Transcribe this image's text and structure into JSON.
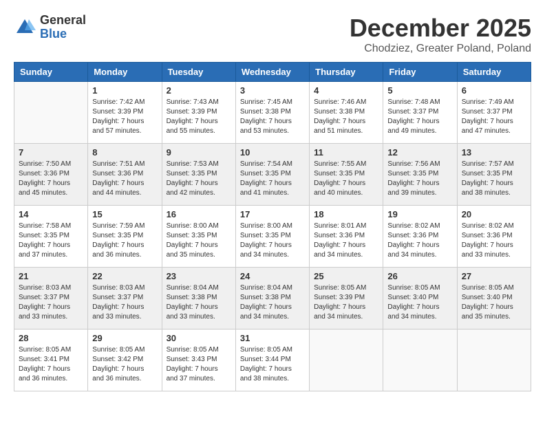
{
  "header": {
    "logo_general": "General",
    "logo_blue": "Blue",
    "month": "December 2025",
    "location": "Chodziez, Greater Poland, Poland"
  },
  "days_of_week": [
    "Sunday",
    "Monday",
    "Tuesday",
    "Wednesday",
    "Thursday",
    "Friday",
    "Saturday"
  ],
  "weeks": [
    [
      {
        "day": "",
        "info": ""
      },
      {
        "day": "1",
        "info": "Sunrise: 7:42 AM\nSunset: 3:39 PM\nDaylight: 7 hours\nand 57 minutes."
      },
      {
        "day": "2",
        "info": "Sunrise: 7:43 AM\nSunset: 3:39 PM\nDaylight: 7 hours\nand 55 minutes."
      },
      {
        "day": "3",
        "info": "Sunrise: 7:45 AM\nSunset: 3:38 PM\nDaylight: 7 hours\nand 53 minutes."
      },
      {
        "day": "4",
        "info": "Sunrise: 7:46 AM\nSunset: 3:38 PM\nDaylight: 7 hours\nand 51 minutes."
      },
      {
        "day": "5",
        "info": "Sunrise: 7:48 AM\nSunset: 3:37 PM\nDaylight: 7 hours\nand 49 minutes."
      },
      {
        "day": "6",
        "info": "Sunrise: 7:49 AM\nSunset: 3:37 PM\nDaylight: 7 hours\nand 47 minutes."
      }
    ],
    [
      {
        "day": "7",
        "info": "Sunrise: 7:50 AM\nSunset: 3:36 PM\nDaylight: 7 hours\nand 45 minutes."
      },
      {
        "day": "8",
        "info": "Sunrise: 7:51 AM\nSunset: 3:36 PM\nDaylight: 7 hours\nand 44 minutes."
      },
      {
        "day": "9",
        "info": "Sunrise: 7:53 AM\nSunset: 3:35 PM\nDaylight: 7 hours\nand 42 minutes."
      },
      {
        "day": "10",
        "info": "Sunrise: 7:54 AM\nSunset: 3:35 PM\nDaylight: 7 hours\nand 41 minutes."
      },
      {
        "day": "11",
        "info": "Sunrise: 7:55 AM\nSunset: 3:35 PM\nDaylight: 7 hours\nand 40 minutes."
      },
      {
        "day": "12",
        "info": "Sunrise: 7:56 AM\nSunset: 3:35 PM\nDaylight: 7 hours\nand 39 minutes."
      },
      {
        "day": "13",
        "info": "Sunrise: 7:57 AM\nSunset: 3:35 PM\nDaylight: 7 hours\nand 38 minutes."
      }
    ],
    [
      {
        "day": "14",
        "info": "Sunrise: 7:58 AM\nSunset: 3:35 PM\nDaylight: 7 hours\nand 37 minutes."
      },
      {
        "day": "15",
        "info": "Sunrise: 7:59 AM\nSunset: 3:35 PM\nDaylight: 7 hours\nand 36 minutes."
      },
      {
        "day": "16",
        "info": "Sunrise: 8:00 AM\nSunset: 3:35 PM\nDaylight: 7 hours\nand 35 minutes."
      },
      {
        "day": "17",
        "info": "Sunrise: 8:00 AM\nSunset: 3:35 PM\nDaylight: 7 hours\nand 34 minutes."
      },
      {
        "day": "18",
        "info": "Sunrise: 8:01 AM\nSunset: 3:36 PM\nDaylight: 7 hours\nand 34 minutes."
      },
      {
        "day": "19",
        "info": "Sunrise: 8:02 AM\nSunset: 3:36 PM\nDaylight: 7 hours\nand 34 minutes."
      },
      {
        "day": "20",
        "info": "Sunrise: 8:02 AM\nSunset: 3:36 PM\nDaylight: 7 hours\nand 33 minutes."
      }
    ],
    [
      {
        "day": "21",
        "info": "Sunrise: 8:03 AM\nSunset: 3:37 PM\nDaylight: 7 hours\nand 33 minutes."
      },
      {
        "day": "22",
        "info": "Sunrise: 8:03 AM\nSunset: 3:37 PM\nDaylight: 7 hours\nand 33 minutes."
      },
      {
        "day": "23",
        "info": "Sunrise: 8:04 AM\nSunset: 3:38 PM\nDaylight: 7 hours\nand 33 minutes."
      },
      {
        "day": "24",
        "info": "Sunrise: 8:04 AM\nSunset: 3:38 PM\nDaylight: 7 hours\nand 34 minutes."
      },
      {
        "day": "25",
        "info": "Sunrise: 8:05 AM\nSunset: 3:39 PM\nDaylight: 7 hours\nand 34 minutes."
      },
      {
        "day": "26",
        "info": "Sunrise: 8:05 AM\nSunset: 3:40 PM\nDaylight: 7 hours\nand 34 minutes."
      },
      {
        "day": "27",
        "info": "Sunrise: 8:05 AM\nSunset: 3:40 PM\nDaylight: 7 hours\nand 35 minutes."
      }
    ],
    [
      {
        "day": "28",
        "info": "Sunrise: 8:05 AM\nSunset: 3:41 PM\nDaylight: 7 hours\nand 36 minutes."
      },
      {
        "day": "29",
        "info": "Sunrise: 8:05 AM\nSunset: 3:42 PM\nDaylight: 7 hours\nand 36 minutes."
      },
      {
        "day": "30",
        "info": "Sunrise: 8:05 AM\nSunset: 3:43 PM\nDaylight: 7 hours\nand 37 minutes."
      },
      {
        "day": "31",
        "info": "Sunrise: 8:05 AM\nSunset: 3:44 PM\nDaylight: 7 hours\nand 38 minutes."
      },
      {
        "day": "",
        "info": ""
      },
      {
        "day": "",
        "info": ""
      },
      {
        "day": "",
        "info": ""
      }
    ]
  ]
}
